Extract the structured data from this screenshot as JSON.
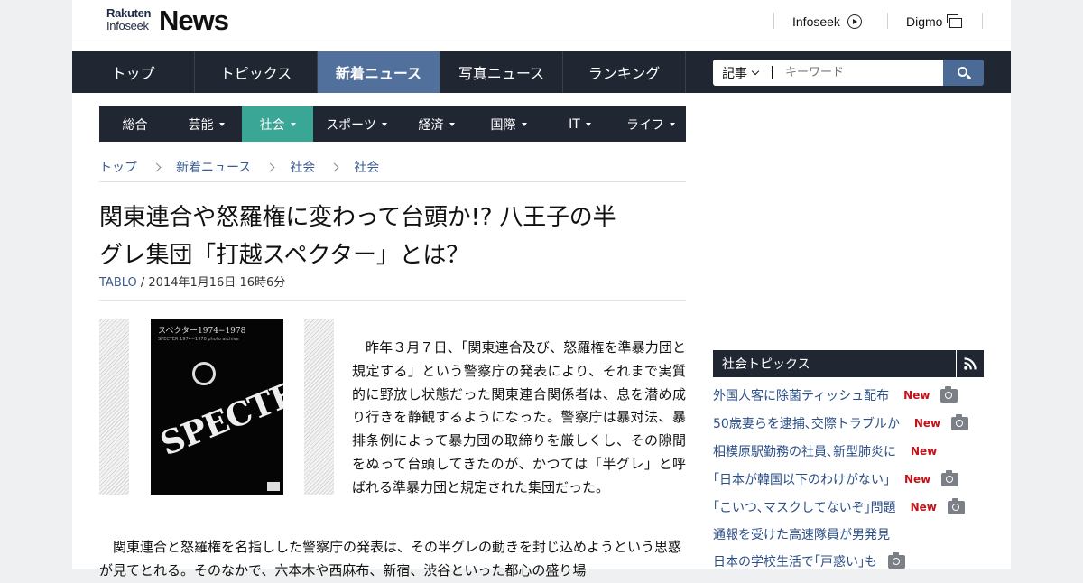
{
  "header": {
    "logo_small_1": "Rakuten",
    "logo_small_2": "Infoseek",
    "logo_big": "News",
    "links": [
      "Infoseek",
      "Digmo"
    ]
  },
  "nav": {
    "items": [
      "トップ",
      "トピックス",
      "新着ニュース",
      "写真ニュース",
      "ランキング"
    ],
    "active_index": 2
  },
  "search": {
    "scope": "記事",
    "placeholder": "キーワード"
  },
  "subnav": {
    "items": [
      "総合",
      "芸能",
      "社会",
      "スポーツ",
      "経済",
      "国際",
      "IT",
      "ライフ"
    ],
    "active_index": 2
  },
  "breadcrumb": [
    "トップ",
    "新着ニュース",
    "社会",
    "社会"
  ],
  "article": {
    "title_line1": "関東連合や怒羅権に変わって台頭か!? 八王子の半",
    "title_line2": "グレ集団「打越スペクター」とは？",
    "source": "TABLO",
    "date": " / 2014年1月16日 16時6分",
    "image": {
      "heading": "スペクター1974−1978",
      "subheading": "SPECTER 1974−1978 photo archive",
      "logo": "SPECTER"
    },
    "lead": "昨年３月７日、「関東連合及び、怒羅権を準暴力団と規定する」という警察庁の発表により、それまで実質的に野放し状態だった関東連合関係者は、息を潜め成り行きを静観するようになった。警察庁は暴対法、暴排条例によって暴力団の取締りを厳しくし、その隙間をぬって台頭してきたのが、かつては「半グレ」と呼ばれる準暴力団と規定された集団だった。",
    "para2": "関東連合と怒羅権を名指しした警察庁の発表は、その半グレの動きを封じ込めようという思惑が見てとれる。そのなかで、六本木や西麻布、新宿、渋谷といった都心の盛り場"
  },
  "sidebar": {
    "title": "社会トピックス",
    "topics": [
      {
        "text": "外国人客に除菌ティッシュ配布",
        "new": "New",
        "photo": true
      },
      {
        "text": "50歳妻らを逮捕､交際トラブルか",
        "new": "New",
        "photo": true
      },
      {
        "text": "相模原駅勤務の社員､新型肺炎に",
        "new": "New",
        "photo": false
      },
      {
        "text": "｢日本が韓国以下のわけがない｣",
        "new": "New",
        "photo": true
      },
      {
        "text": "｢こいつ､マスクしてないぞ｣問題",
        "new": "New",
        "photo": true
      },
      {
        "text": "通報を受けた高速隊員が男発見",
        "new": "",
        "photo": false
      },
      {
        "text": "日本の学校生活で｢戸惑い｣も",
        "new": "",
        "photo": true
      }
    ]
  },
  "colors": {
    "nav_bg": "#202632",
    "nav_active": "#52709c",
    "subnav_active": "#3aa796",
    "link": "#3b5b8f",
    "new_badge": "#c4121a"
  }
}
